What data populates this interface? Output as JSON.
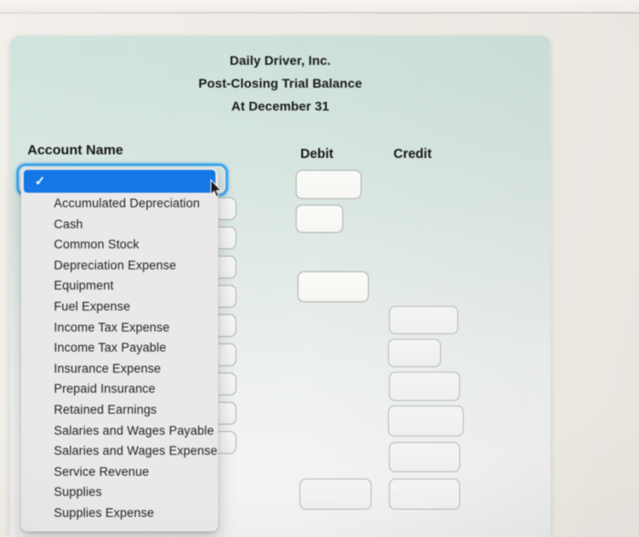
{
  "report": {
    "company_name": "Daily Driver, Inc.",
    "title": "Post-Closing Trial Balance",
    "date_line": "At December 31"
  },
  "columns": {
    "account_name": "Account Name",
    "debit": "Debit",
    "credit": "Credit"
  },
  "dropdown": {
    "selected_label": "",
    "check_glyph": "✓",
    "options": [
      "",
      "Accumulated Depreciation",
      "Cash",
      "Common Stock",
      "Depreciation Expense",
      "Equipment",
      "Fuel Expense",
      "Income Tax Expense",
      "Income Tax Payable",
      "Insurance Expense",
      "Prepaid Insurance",
      "Retained Earnings",
      "Salaries and Wages Payable",
      "Salaries and Wages Expense",
      "Service Revenue",
      "Supplies",
      "Supplies Expense"
    ]
  },
  "account_rows": [
    {
      "name_value": "",
      "debit_value": "",
      "credit_value": ""
    },
    {
      "name_value": "",
      "debit_value": "",
      "credit_value": ""
    },
    {
      "name_value": "",
      "debit_value": "",
      "credit_value": ""
    },
    {
      "name_value": "",
      "debit_value": "",
      "credit_value": ""
    },
    {
      "name_value": "",
      "debit_value": "",
      "credit_value": ""
    },
    {
      "name_value": "",
      "debit_value": "",
      "credit_value": ""
    },
    {
      "name_value": "",
      "debit_value": "",
      "credit_value": ""
    },
    {
      "name_value": "",
      "debit_value": "",
      "credit_value": ""
    },
    {
      "name_value": "",
      "debit_value": "",
      "credit_value": ""
    },
    {
      "name_value": "",
      "debit_value": "",
      "credit_value": ""
    }
  ],
  "colors": {
    "card_teal": "#cadfd8",
    "card_bottom": "#f0f2f1",
    "selection_blue": "#1477e6",
    "focus_ring_blue": "#3da7ef",
    "dropdown_bg": "#e9e9e9",
    "field_border": "#a9aeb0",
    "text_dark": "#17181a",
    "desk_background": "#efece8"
  }
}
